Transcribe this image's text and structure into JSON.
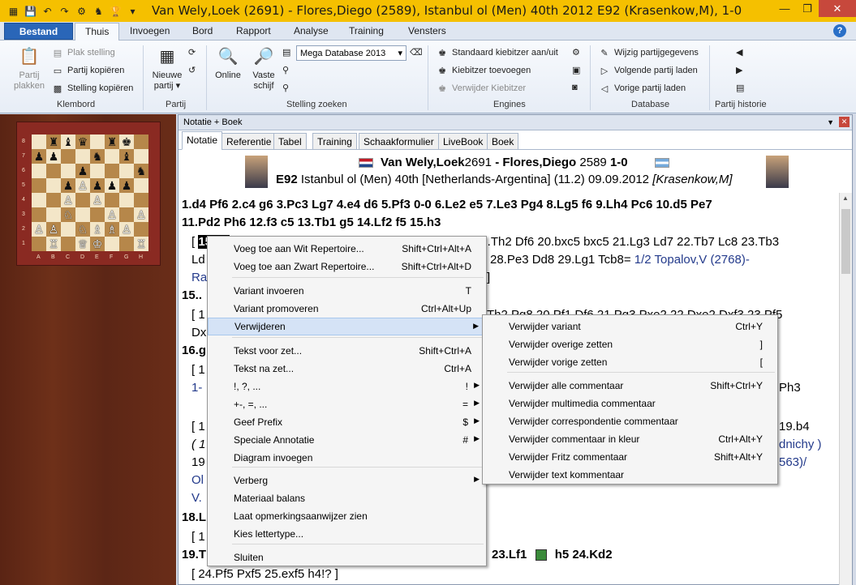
{
  "window": {
    "title": "Van Wely,Loek (2691) - Flores,Diego (2589), Istanbul ol (Men) 40th 2012  E92  (Krasenkow,M), 1-0"
  },
  "ribbon_tabs": {
    "file": "Bestand",
    "tabs": [
      "Thuis",
      "Invoegen",
      "Bord",
      "Rapport",
      "Analyse",
      "Training",
      "Vensters"
    ]
  },
  "ribbon": {
    "klembord": {
      "label": "Klembord",
      "partij_plakken": "Partij\nplakken",
      "plak_stelling": "Plak stelling",
      "partij_kopieren": "Partij kopiëren",
      "stelling_kopieren": "Stelling kopiëren"
    },
    "partij": {
      "label": "Partij",
      "nieuwe": "Nieuwe",
      "partij": "partij ▾"
    },
    "stelling_zoeken": {
      "label": "Stelling zoeken",
      "online": "Online",
      "vaste": "Vaste",
      "schijf": "schijf",
      "database": "Mega Database 2013"
    },
    "engines": {
      "label": "Engines",
      "standaard": "Standaard kiebitzer aan/uit",
      "toevoegen": "Kiebitzer toevoegen",
      "verwijder": "Verwijder Kiebitzer"
    },
    "database": {
      "label": "Database",
      "wijzig": "Wijzig partijgegevens",
      "volgende": "Volgende partij laden",
      "vorige": "Vorige partij laden"
    },
    "historie": {
      "label": "Partij historie"
    }
  },
  "pane": {
    "title": "Notatie + Boek",
    "tabs": [
      "Notatie",
      "Referentie",
      "Tabel",
      "Training",
      "Schaakformulier",
      "LiveBook",
      "Boek"
    ]
  },
  "game_header": {
    "white": "Van Wely,Loek",
    "white_elo": "2691",
    "sep": " - ",
    "black": "Flores,Diego",
    "black_elo": "2589",
    "result": "1-0",
    "eco": "E92",
    "event": "Istanbul ol (Men) 40th [Netherlands-Argentina] (11.2) 09.09.2012",
    "annotator": "[Krasenkow,M]"
  },
  "notation": {
    "line1": "1.d4  Pf6  2.c4  g6  3.Pc3  Lg7  4.e4  d6  5.Pf3  0-0  6.Le2  e5  7.Le3  Pg4  8.Lg5  f6  9.Lh4  Pc6  10.d5  Pe7",
    "line2": "11.Pd2  Ph6  12.f3  c5  13.Tb1  g5  14.Lf2  f5  15.h3",
    "line3_pre": "[",
    "line3_hl": "15.Lc",
    "line3_post": "19.Th2  Df6  20.bxc5  bxc5  21.Lg3  Ld7  22.Tb7  Lc8  23.Tb3",
    "line4_pre": "Ld",
    "line4_mid": "28.Pe3  Dd8  29.Lg1  Tcb8=",
    "line4_blue": "1/2 Topalov,V (2768)-",
    "line5_blue": "Ra",
    "line5_end": "]",
    "line6": "15..",
    "line7_pre": "[ 1",
    "line7_post": "Th2  Pg8  20.Pf1  Df6  21.Pg3  Pxe2  22.Dxe2  Dxf3  23.Pf5",
    "line8": "Dx",
    "line9": "16.g",
    "line10": "[ 1",
    "line11_blue": "1-",
    "line11_end": "Ph3",
    "line12_pre": "[ 1",
    "line12_end": "19.b4",
    "line13_it": "( 1",
    "line13_blue": "dnichy )",
    "line14_pre": "19",
    "line14_blue": "563)/",
    "line15_blue": "Ol",
    "line16_blue": "V.",
    "line17": "18.L",
    "line18": "[ 1",
    "line19_pre": "19.T",
    "line19_post": "23.Lf1",
    "line19_tail": "h5  24.Kd2",
    "line20": "[ 24.Pf5  Pxf5  25.exf5  h4!? ]"
  },
  "context_menu": [
    {
      "label": "Voeg toe aan Wit Repertoire...",
      "shortcut": "Shift+Ctrl+Alt+A"
    },
    {
      "label": "Voeg toe aan Zwart Repertoire...",
      "shortcut": "Shift+Ctrl+Alt+D"
    },
    {
      "label": "Variant invoeren",
      "shortcut": "T"
    },
    {
      "label": "Variant promoveren",
      "shortcut": "Ctrl+Alt+Up"
    },
    {
      "label": "Verwijderen",
      "shortcut": ""
    },
    {
      "label": "Tekst voor zet...",
      "shortcut": "Shift+Ctrl+A"
    },
    {
      "label": "Tekst na zet...",
      "shortcut": "Ctrl+A"
    },
    {
      "label": "!, ?, ...",
      "shortcut": "!"
    },
    {
      "label": "+-, =, ...",
      "shortcut": "="
    },
    {
      "label": "Geef Prefix",
      "shortcut": "$"
    },
    {
      "label": "Speciale Annotatie",
      "shortcut": "#"
    },
    {
      "label": "Diagram invoegen",
      "shortcut": ""
    },
    {
      "label": "Verberg",
      "shortcut": ""
    },
    {
      "label": "Materiaal balans",
      "shortcut": ""
    },
    {
      "label": "Laat opmerkingsaanwijzer zien",
      "shortcut": ""
    },
    {
      "label": "Kies lettertype...",
      "shortcut": ""
    },
    {
      "label": "Sluiten",
      "shortcut": ""
    }
  ],
  "submenu": [
    {
      "label": "Verwijder variant",
      "shortcut": "Ctrl+Y"
    },
    {
      "label": "Verwijder overige zetten",
      "shortcut": "]"
    },
    {
      "label": "Verwijder vorige zetten",
      "shortcut": "["
    },
    {
      "label": "Verwijder alle commentaar",
      "shortcut": "Shift+Ctrl+Y"
    },
    {
      "label": "Verwijder multimedia commentaar",
      "shortcut": ""
    },
    {
      "label": "Verwijder correspondentie commentaar",
      "shortcut": ""
    },
    {
      "label": "Verwijder commentaar in kleur",
      "shortcut": "Ctrl+Alt+Y"
    },
    {
      "label": "Verwijder Fritz commentaar",
      "shortcut": "Shift+Alt+Y"
    },
    {
      "label": "Verwijder text kommentaar",
      "shortcut": ""
    }
  ],
  "board": {
    "ranks": [
      "8",
      "7",
      "6",
      "5",
      "4",
      "3",
      "2",
      "1"
    ],
    "files": [
      "A",
      "B",
      "C",
      "D",
      "E",
      "F",
      "G",
      "H"
    ],
    "position": [
      [
        "",
        "♜",
        "♝",
        "♛",
        "",
        "♜",
        "♚",
        ""
      ],
      [
        "♟",
        "♟",
        "",
        "",
        "♞",
        "",
        "♝",
        ""
      ],
      [
        "",
        "",
        "",
        "♟",
        "",
        "",
        "",
        "♞"
      ],
      [
        "",
        "",
        "♟",
        "♙",
        "♟",
        "♟",
        "♟",
        ""
      ],
      [
        "",
        "",
        "♙",
        "",
        "♙",
        "",
        "",
        ""
      ],
      [
        "",
        "",
        "♘",
        "",
        "",
        "♙",
        "",
        "♙"
      ],
      [
        "♙",
        "♙",
        "",
        "♘",
        "♗",
        "♗",
        "♙",
        ""
      ],
      [
        "",
        "♖",
        "",
        "♕",
        "♔",
        "",
        "",
        "♖"
      ]
    ]
  },
  "colors": {
    "titlebar": "#f5c000",
    "file_tab": "#2a66b8",
    "wood": "#5a2414",
    "blue_text": "#233a8b"
  }
}
